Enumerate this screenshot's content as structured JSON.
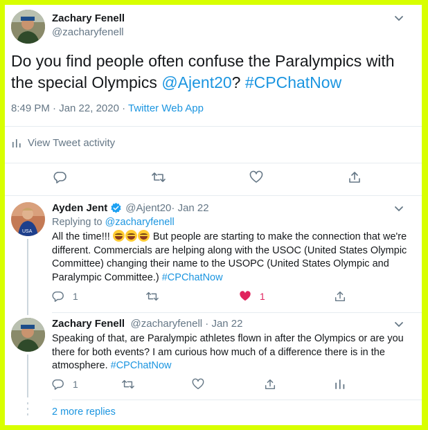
{
  "main_tweet": {
    "author_name": "Zachary Fenell",
    "author_handle": "@zacharyfenell",
    "text_before": "Do you find people often confuse the Paralympics with the special Olympics ",
    "mention": "@Ajent20",
    "text_middle": "? ",
    "hashtag": "#CPChatNow",
    "timestamp": "8:49 PM · Jan 22, 2020 · ",
    "source": "Twitter Web App",
    "activity_label": "View Tweet activity"
  },
  "reply1": {
    "author_name": "Ayden Jent",
    "author_handle": "@Ajent20",
    "date": " · Jan 22",
    "replying_to_label": "Replying to ",
    "replying_to_handle": "@zacharyfenell",
    "text_before_emoji": "All the time!!! ",
    "text_after_emoji": " But people are starting to make the connection that we're different. Commercials are helping along with the USOC (United States Olympic Committee) changing their name to the USOPC (United States Olympic and Paralympic Committee.) ",
    "hashtag": "#CPChatNow",
    "reply_count": "1",
    "like_count": "1"
  },
  "reply2": {
    "author_name": "Zachary Fenell",
    "author_handle": "@zacharyfenell",
    "date": " · Jan 22",
    "text": "Speaking of that, are Paralympic athletes flown in after the Olympics or are you there for both events? I am curious how much of a difference there is in the atmosphere. ",
    "hashtag": "#CPChatNow",
    "reply_count": "1"
  },
  "more_replies": "2 more replies",
  "colors": {
    "background_frame": "#d8ff00",
    "accent": "#1b95e0",
    "like": "#e0245e",
    "muted": "#657786",
    "verified": "#1da1f2"
  },
  "icons": [
    "chevron-down-icon",
    "reply-icon",
    "retweet-icon",
    "heart-icon",
    "share-icon",
    "analytics-icon",
    "verified-badge-icon"
  ]
}
